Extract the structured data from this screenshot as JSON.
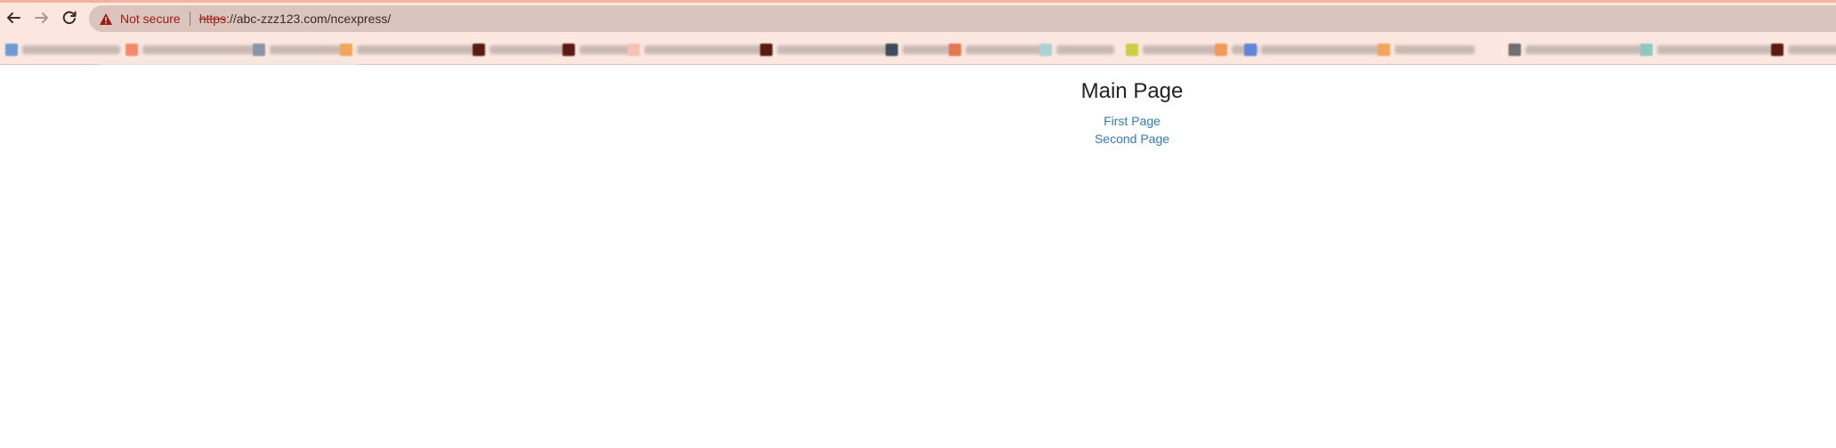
{
  "browser": {
    "security_label": "Not secure",
    "url_scheme": "https",
    "url_rest": "://abc-zzz123.com/ncexpress/",
    "bookmarks": [
      {
        "icon_color": "#6b9bd1"
      },
      {
        "icon_color": "#f28a6a"
      },
      {
        "icon_color": "#8a95a8"
      },
      {
        "icon_color": "#f2a65a"
      },
      {
        "icon_color": "#5a1a12"
      },
      {
        "icon_color": "#5a1a12"
      },
      {
        "icon_color": "#f6c3b3"
      },
      {
        "icon_color": "#5a1a12"
      },
      {
        "icon_color": "#3f4a5c"
      },
      {
        "icon_color": "#e3774f"
      },
      {
        "icon_color": "#a9d3d3"
      },
      {
        "icon_color": "#c8cf44"
      },
      {
        "icon_color": "#f29a55"
      },
      {
        "icon_color": "#5f86d9"
      },
      {
        "icon_color": "#f2a65a"
      },
      {
        "icon_color": "#6f6f6f"
      },
      {
        "icon_color": "#8cc9c0"
      },
      {
        "icon_color": "#5a1a12"
      }
    ]
  },
  "page": {
    "title": "Main Page",
    "links": {
      "first": "First Page",
      "second": "Second Page"
    }
  },
  "colors": {
    "chrome_bg": "#fbe6e0",
    "omnibox_bg": "#dcc4be",
    "warning": "#9a1b12",
    "link": "#337ab7"
  },
  "icons": {
    "back": "back-arrow-icon",
    "forward": "forward-arrow-icon",
    "reload": "reload-icon",
    "warning": "warning-triangle-icon"
  }
}
